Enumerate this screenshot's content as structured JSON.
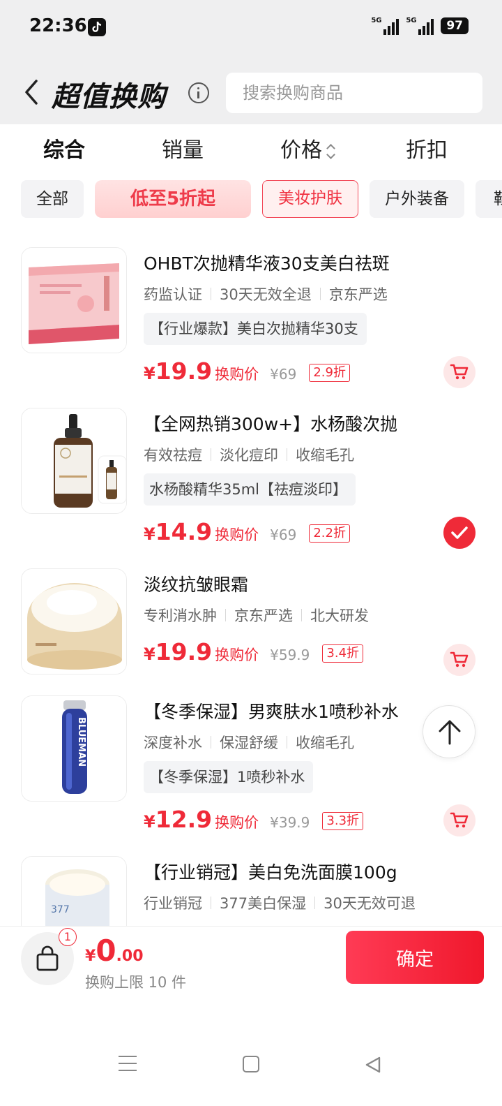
{
  "status_bar": {
    "time": "22:36",
    "net1": "5G",
    "net2": "5G",
    "battery": "97",
    "app_icon": "tiktok-icon"
  },
  "header": {
    "title": "超值换购",
    "search_placeholder": "搜索换购商品"
  },
  "sort_tabs": [
    {
      "label": "综合",
      "active": true
    },
    {
      "label": "销量",
      "active": false
    },
    {
      "label": "价格",
      "active": false
    },
    {
      "label": "折扣",
      "active": false
    }
  ],
  "chips": [
    {
      "label": "全部"
    },
    {
      "label": "低至5折起"
    },
    {
      "label": "美妆护肤",
      "selected": true
    },
    {
      "label": "户外装备"
    },
    {
      "label": "鞋"
    }
  ],
  "products": [
    {
      "title": "OHBT次抛精华液30支美白祛斑",
      "tags": [
        "药监认证",
        "30天无效全退",
        "京东严选"
      ],
      "badge": "【行业爆款】美白次抛精华30支",
      "price": "19.9",
      "price_label": "换购价",
      "original_price": "¥69",
      "discount": "2.9折",
      "selected": false
    },
    {
      "title": "【全网热销300w+】水杨酸次抛",
      "tags": [
        "有效祛痘",
        "淡化痘印",
        "收缩毛孔"
      ],
      "badge": "水杨酸精华35ml【祛痘淡印】",
      "price": "14.9",
      "price_label": "换购价",
      "original_price": "¥69",
      "discount": "2.2折",
      "selected": true
    },
    {
      "title": "淡纹抗皱眼霜",
      "tags": [
        "专利消水肿",
        "京东严选",
        "北大研发"
      ],
      "badge": "",
      "price": "19.9",
      "price_label": "换购价",
      "original_price": "¥59.9",
      "discount": "3.4折",
      "selected": false
    },
    {
      "title": "【冬季保湿】男爽肤水1喷秒补水",
      "tags": [
        "深度补水",
        "保湿舒缓",
        "收缩毛孔"
      ],
      "badge": "【冬季保湿】1喷秒补水",
      "price": "12.9",
      "price_label": "换购价",
      "original_price": "¥39.9",
      "discount": "3.3折",
      "selected": false
    },
    {
      "title": "【行业销冠】美白免洗面膜100g",
      "tags": [
        "行业销冠",
        "377美白保湿",
        "30天无效可退"
      ],
      "badge": "",
      "price": "",
      "price_label": "",
      "original_price": "",
      "discount": "",
      "selected": false
    }
  ],
  "checkout": {
    "bag_count": "1",
    "currency": "¥",
    "total_int": "0",
    "total_dec": ".00",
    "limit_text": "换购上限 10 件",
    "confirm_label": "确定"
  },
  "colors": {
    "accent": "#ef2a38",
    "header_bg": "#efeff0",
    "chip_bg": "#f3f3f5"
  }
}
